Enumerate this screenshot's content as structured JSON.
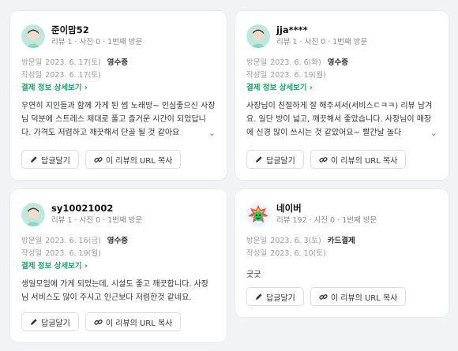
{
  "reviews": [
    {
      "name": "준이맘52",
      "meta": {
        "reviews": "리뷰 1",
        "photos": "사진 0",
        "visit": "1번째 방문"
      },
      "visit_label": "방문일",
      "visit_date": "2023. 6. 17(토)",
      "receipt": "영수증",
      "write_label": "작성일",
      "write_date": "2023. 6. 17(토)",
      "detail_link": "결제 정보 상세보기 ›",
      "text": "우연히 지인들과 함께 가게 된 썸 노래방~ 인심좋으신 사장님 덕분에 스트레스 제대로 풀고 즐거운 시간이 되었답니다. 가격도 저렴하고 깨끗해서 단골 될 것 같아요",
      "reply_btn": "답글달기",
      "url_btn": "이 리뷰의 URL 복사"
    },
    {
      "name": "jja****",
      "meta": {
        "reviews": "리뷰 1",
        "photos": "사진 0",
        "visit": "1번째 방문"
      },
      "visit_label": "방문일",
      "visit_date": "2023. 6. 6(화)",
      "receipt": "영수증",
      "write_label": "작성일",
      "write_date": "2023. 6. 19(월)",
      "detail_link": "결제 정보 상세보기 ›",
      "text": "사장님이 친절하게 잘 해주셔서(서비스ㄷㅋㅋ) 리뷰 남겨요. 일단 방이 넓고, 깨끗해서 좋았습니다. 사장님이 매장에 신경 많이 쓰시는 것 같았어요~ 빨간날 놀다",
      "reply_btn": "답글달기",
      "url_btn": "이 리뷰의 URL 복사"
    },
    {
      "name": "sy10021002",
      "meta": {
        "reviews": "리뷰 1",
        "photos": "사진 0",
        "visit": "1번째 방문"
      },
      "visit_label": "방문일",
      "visit_date": "2023. 6. 16(금)",
      "receipt": "영수증",
      "write_label": "작성일",
      "write_date": "2023. 6. 19(월)",
      "detail_link": "결제 정보 상세보기 ›",
      "text": "생일모임에 가게 되었는데, 시설도 좋고 깨끗합니다. 사장님 서비스도 많이 주시고 인근보다 저렴한것 같네요.",
      "reply_btn": "답글달기",
      "url_btn": "이 리뷰의 URL 복사"
    },
    {
      "name": "네이버",
      "meta": {
        "reviews": "리뷰 192",
        "photos": "사진 0",
        "visit": "1번째 방문"
      },
      "visit_label": "방문일",
      "visit_date": "2023. 6. 3(토)",
      "receipt": "카드결제",
      "write_label": "작성일",
      "write_date": "2023. 6. 10(토)",
      "text": "굿굿",
      "reply_btn": "답글달기",
      "url_btn": "이 리뷰의 URL 복사"
    }
  ],
  "icons": {
    "reply": "pencil-icon",
    "url": "link-icon",
    "more": "chevron-down-icon"
  },
  "colors": {
    "link_green": "#18a36b",
    "background": "#f2f3f5",
    "card": "#ffffff"
  }
}
